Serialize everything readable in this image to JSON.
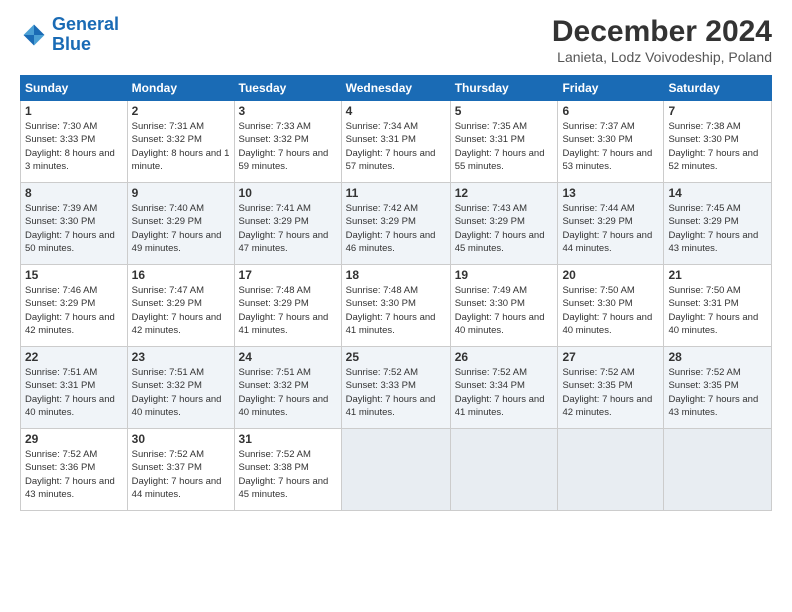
{
  "logo": {
    "line1": "General",
    "line2": "Blue"
  },
  "title": "December 2024",
  "subtitle": "Lanieta, Lodz Voivodeship, Poland",
  "weekdays": [
    "Sunday",
    "Monday",
    "Tuesday",
    "Wednesday",
    "Thursday",
    "Friday",
    "Saturday"
  ],
  "weeks": [
    [
      {
        "day": "1",
        "sunrise": "7:30 AM",
        "sunset": "3:33 PM",
        "daylight": "8 hours and 3 minutes."
      },
      {
        "day": "2",
        "sunrise": "7:31 AM",
        "sunset": "3:32 PM",
        "daylight": "8 hours and 1 minute."
      },
      {
        "day": "3",
        "sunrise": "7:33 AM",
        "sunset": "3:32 PM",
        "daylight": "7 hours and 59 minutes."
      },
      {
        "day": "4",
        "sunrise": "7:34 AM",
        "sunset": "3:31 PM",
        "daylight": "7 hours and 57 minutes."
      },
      {
        "day": "5",
        "sunrise": "7:35 AM",
        "sunset": "3:31 PM",
        "daylight": "7 hours and 55 minutes."
      },
      {
        "day": "6",
        "sunrise": "7:37 AM",
        "sunset": "3:30 PM",
        "daylight": "7 hours and 53 minutes."
      },
      {
        "day": "7",
        "sunrise": "7:38 AM",
        "sunset": "3:30 PM",
        "daylight": "7 hours and 52 minutes."
      }
    ],
    [
      {
        "day": "8",
        "sunrise": "7:39 AM",
        "sunset": "3:30 PM",
        "daylight": "7 hours and 50 minutes."
      },
      {
        "day": "9",
        "sunrise": "7:40 AM",
        "sunset": "3:29 PM",
        "daylight": "7 hours and 49 minutes."
      },
      {
        "day": "10",
        "sunrise": "7:41 AM",
        "sunset": "3:29 PM",
        "daylight": "7 hours and 47 minutes."
      },
      {
        "day": "11",
        "sunrise": "7:42 AM",
        "sunset": "3:29 PM",
        "daylight": "7 hours and 46 minutes."
      },
      {
        "day": "12",
        "sunrise": "7:43 AM",
        "sunset": "3:29 PM",
        "daylight": "7 hours and 45 minutes."
      },
      {
        "day": "13",
        "sunrise": "7:44 AM",
        "sunset": "3:29 PM",
        "daylight": "7 hours and 44 minutes."
      },
      {
        "day": "14",
        "sunrise": "7:45 AM",
        "sunset": "3:29 PM",
        "daylight": "7 hours and 43 minutes."
      }
    ],
    [
      {
        "day": "15",
        "sunrise": "7:46 AM",
        "sunset": "3:29 PM",
        "daylight": "7 hours and 42 minutes."
      },
      {
        "day": "16",
        "sunrise": "7:47 AM",
        "sunset": "3:29 PM",
        "daylight": "7 hours and 42 minutes."
      },
      {
        "day": "17",
        "sunrise": "7:48 AM",
        "sunset": "3:29 PM",
        "daylight": "7 hours and 41 minutes."
      },
      {
        "day": "18",
        "sunrise": "7:48 AM",
        "sunset": "3:30 PM",
        "daylight": "7 hours and 41 minutes."
      },
      {
        "day": "19",
        "sunrise": "7:49 AM",
        "sunset": "3:30 PM",
        "daylight": "7 hours and 40 minutes."
      },
      {
        "day": "20",
        "sunrise": "7:50 AM",
        "sunset": "3:30 PM",
        "daylight": "7 hours and 40 minutes."
      },
      {
        "day": "21",
        "sunrise": "7:50 AM",
        "sunset": "3:31 PM",
        "daylight": "7 hours and 40 minutes."
      }
    ],
    [
      {
        "day": "22",
        "sunrise": "7:51 AM",
        "sunset": "3:31 PM",
        "daylight": "7 hours and 40 minutes."
      },
      {
        "day": "23",
        "sunrise": "7:51 AM",
        "sunset": "3:32 PM",
        "daylight": "7 hours and 40 minutes."
      },
      {
        "day": "24",
        "sunrise": "7:51 AM",
        "sunset": "3:32 PM",
        "daylight": "7 hours and 40 minutes."
      },
      {
        "day": "25",
        "sunrise": "7:52 AM",
        "sunset": "3:33 PM",
        "daylight": "7 hours and 41 minutes."
      },
      {
        "day": "26",
        "sunrise": "7:52 AM",
        "sunset": "3:34 PM",
        "daylight": "7 hours and 41 minutes."
      },
      {
        "day": "27",
        "sunrise": "7:52 AM",
        "sunset": "3:35 PM",
        "daylight": "7 hours and 42 minutes."
      },
      {
        "day": "28",
        "sunrise": "7:52 AM",
        "sunset": "3:35 PM",
        "daylight": "7 hours and 43 minutes."
      }
    ],
    [
      {
        "day": "29",
        "sunrise": "7:52 AM",
        "sunset": "3:36 PM",
        "daylight": "7 hours and 43 minutes."
      },
      {
        "day": "30",
        "sunrise": "7:52 AM",
        "sunset": "3:37 PM",
        "daylight": "7 hours and 44 minutes."
      },
      {
        "day": "31",
        "sunrise": "7:52 AM",
        "sunset": "3:38 PM",
        "daylight": "7 hours and 45 minutes."
      },
      null,
      null,
      null,
      null
    ]
  ],
  "labels": {
    "sunrise": "Sunrise:",
    "sunset": "Sunset:",
    "daylight": "Daylight:"
  }
}
